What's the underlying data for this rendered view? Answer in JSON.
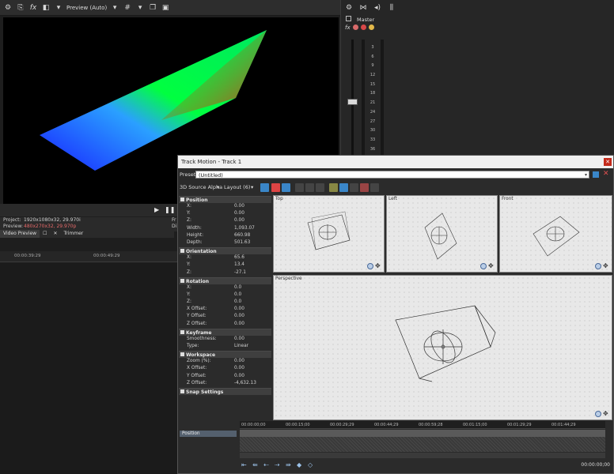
{
  "preview": {
    "quality": "Preview (Auto)",
    "project_label": "Project:",
    "project_value": "1920x1080x32, 29.970i",
    "preview_label": "Preview:",
    "preview_value": "480x270x32, 29.970p",
    "frame_label": "Fr",
    "display_label": "Di",
    "tabs": [
      "Video Preview",
      "Trimmer"
    ]
  },
  "timeline": {
    "ruler": [
      "00:00:39:29",
      "00:00:49:29"
    ]
  },
  "mixer": {
    "label": "Master",
    "scale": [
      "3",
      "6",
      "9",
      "12",
      "15",
      "18",
      "21",
      "24",
      "27",
      "30",
      "33",
      "36"
    ]
  },
  "track_motion": {
    "title": "Track Motion - Track 1",
    "preset_label": "Preset:",
    "preset_value": "(Untitled)",
    "mode": "3D Source Alpha",
    "layout": "Layout (6)",
    "sections": [
      {
        "name": "Position",
        "rows": [
          {
            "k": "X:",
            "v": "0.00"
          },
          {
            "k": "Y:",
            "v": "0.00"
          },
          {
            "k": "Z:",
            "v": "0.00"
          },
          {
            "k": "Width:",
            "v": "1,093.07"
          },
          {
            "k": "Height:",
            "v": "660.98"
          },
          {
            "k": "Depth:",
            "v": "501.63"
          }
        ]
      },
      {
        "name": "Orientation",
        "rows": [
          {
            "k": "X:",
            "v": "65.6"
          },
          {
            "k": "Y:",
            "v": "13.4"
          },
          {
            "k": "Z:",
            "v": "-27.1"
          }
        ]
      },
      {
        "name": "Rotation",
        "rows": [
          {
            "k": "X:",
            "v": "0.0"
          },
          {
            "k": "Y:",
            "v": "0.0"
          },
          {
            "k": "Z:",
            "v": "0.0"
          },
          {
            "k": "X Offset:",
            "v": "0.00"
          },
          {
            "k": "Y Offset:",
            "v": "0.00"
          },
          {
            "k": "Z Offset:",
            "v": "0.00"
          }
        ]
      },
      {
        "name": "Keyframe",
        "rows": [
          {
            "k": "Smoothness:",
            "v": "0.00"
          },
          {
            "k": "Type:",
            "v": "Linear"
          }
        ]
      },
      {
        "name": "Workspace",
        "rows": [
          {
            "k": "Zoom (%):",
            "v": "0.00"
          },
          {
            "k": "X Offset:",
            "v": "0.00"
          },
          {
            "k": "Y Offset:",
            "v": "0.00"
          },
          {
            "k": "Z Offset:",
            "v": "-4,632.13"
          }
        ]
      },
      {
        "name": "Snap Settings",
        "rows": []
      }
    ],
    "viewports": [
      "Top",
      "Left",
      "Front",
      "Perspective"
    ],
    "keyframe_track": "Position",
    "ruler": [
      "00:00:00;00",
      "00:00:15;00",
      "00:00:29;29",
      "00:00:44;29",
      "00:00:59;28",
      "00:01:15;00",
      "00:01:29;29",
      "00:01:44;29"
    ],
    "time": "00:00:00;00"
  },
  "colors": {
    "accent": "#3a86c8",
    "close_red": "#c42b1c"
  }
}
